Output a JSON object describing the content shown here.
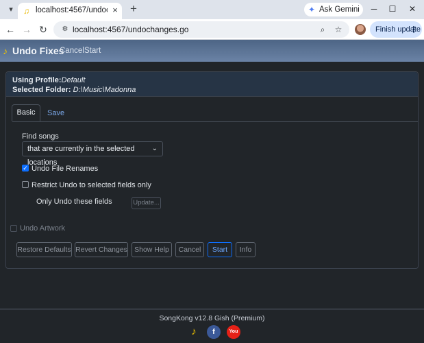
{
  "browser": {
    "tab_title": "localhost:4567/undochanges.go",
    "gemini_label": "Ask Gemini",
    "url": "localhost:4567/undochanges.go",
    "finish_update_label": "Finish update"
  },
  "app": {
    "brand": "Undo Fixes",
    "nav": {
      "cancel": "Cancel",
      "start": "Start"
    }
  },
  "profile": {
    "profile_label": "Using Profile:",
    "profile_value": "Default",
    "folder_label": "Selected Folder:",
    "folder_value": "D:\\Music\\Madonna"
  },
  "tabs": {
    "basic": "Basic",
    "save": "Save"
  },
  "form": {
    "find_songs_label": "Find songs",
    "find_songs_selected": "that are currently in the selected locations",
    "undo_file_renames": {
      "label": "Undo File Renames",
      "checked": true
    },
    "restrict_undo": {
      "label": "Restrict Undo to selected fields only",
      "checked": false
    },
    "only_undo_fields_label": "Only Undo these fields",
    "update_button": "Update...",
    "undo_artwork": {
      "label": "Undo Artwork",
      "checked": false
    }
  },
  "buttons": {
    "restore_defaults": "Restore Defaults",
    "revert_changes": "Revert Changes",
    "show_help": "Show Help",
    "cancel": "Cancel",
    "start": "Start",
    "info": "Info"
  },
  "footer": {
    "version": "SongKong v12.8 Gish (Premium)"
  },
  "colors": {
    "header_start": "#4d6585",
    "header_end": "#6b83a6",
    "primary": "#0d6efd",
    "facebook": "#3b5998",
    "youtube": "#e62117",
    "logo_yellow": "#f0c400"
  }
}
